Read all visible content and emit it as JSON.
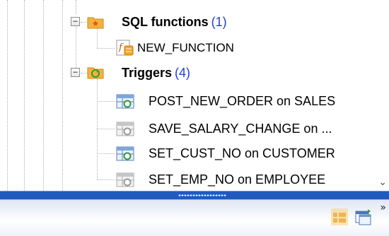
{
  "tree": {
    "groups": [
      {
        "label": "SQL functions",
        "count": "(1)",
        "toggle": "−",
        "icon": "function-folder-icon",
        "items": [
          {
            "label": "NEW_FUNCTION",
            "icon": "function-icon"
          }
        ]
      },
      {
        "label": "Triggers",
        "count": "(4)",
        "toggle": "−",
        "icon": "trigger-folder-icon",
        "items": [
          {
            "label": "POST_NEW_ORDER on SALES",
            "icon": "trigger-icon"
          },
          {
            "label": "SAVE_SALARY_CHANGE on ...",
            "icon": "trigger-inactive-icon"
          },
          {
            "label": "SET_CUST_NO on CUSTOMER",
            "icon": "trigger-icon"
          },
          {
            "label": "SET_EMP_NO on EMPLOYEE",
            "icon": "trigger-inactive-icon"
          }
        ]
      }
    ]
  },
  "scrollbar": {
    "down_arrow": "⌄"
  },
  "toolbar": {
    "more": "»"
  },
  "colors": {
    "count_blue": "#1f3fd1",
    "splitter_blue": "#1f5bbf"
  }
}
